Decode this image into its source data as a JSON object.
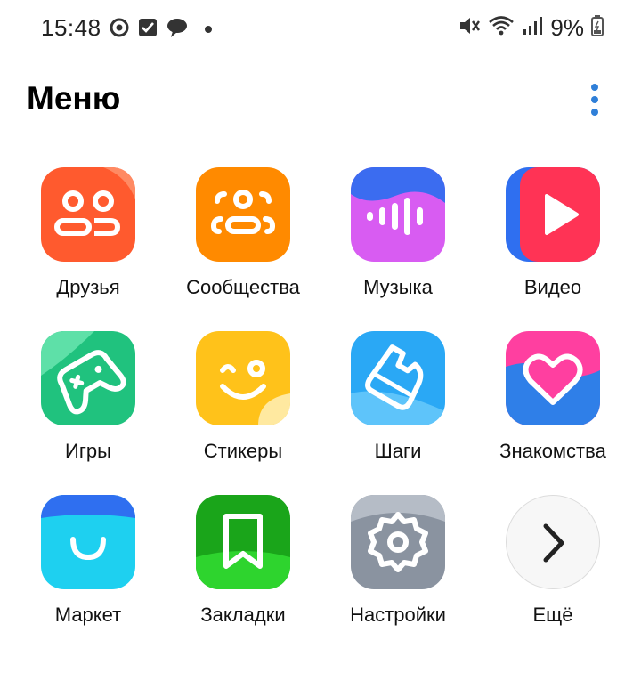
{
  "status_bar": {
    "time": "15:48",
    "battery_percent": "9%",
    "left_icons": [
      "vk-circle-icon",
      "checkbox-icon",
      "chat-bubble-icon",
      "dot-icon"
    ],
    "right_icons": [
      "mute-icon",
      "wifi-icon",
      "signal-icon",
      "battery-icon"
    ]
  },
  "header": {
    "title": "Меню",
    "more_icon": "more-vertical-icon",
    "accent_color": "#2f7fd8"
  },
  "menu_items": [
    {
      "label": "Друзья",
      "icon": "friends-icon",
      "color": "#ff5a2e"
    },
    {
      "label": "Сообщества",
      "icon": "communities-icon",
      "color": "#ff8a00"
    },
    {
      "label": "Музыка",
      "icon": "music-icon",
      "color": "#d85cf2"
    },
    {
      "label": "Видео",
      "icon": "video-icon",
      "color": "#ff3355"
    },
    {
      "label": "Игры",
      "icon": "games-icon",
      "color": "#2ec784"
    },
    {
      "label": "Стикеры",
      "icon": "stickers-icon",
      "color": "#ffc21a"
    },
    {
      "label": "Шаги",
      "icon": "steps-icon",
      "color": "#2aa8f5"
    },
    {
      "label": "Знакомства",
      "icon": "dating-icon",
      "color": "#ff3fa0"
    },
    {
      "label": "Маркет",
      "icon": "market-icon",
      "color": "#1ed0f0"
    },
    {
      "label": "Закладки",
      "icon": "bookmarks-icon",
      "color": "#1bb51b"
    },
    {
      "label": "Настройки",
      "icon": "settings-icon",
      "color": "#8a93a0"
    },
    {
      "label": "Ещё",
      "icon": "chevron-right-icon",
      "color": "#f7f7f7"
    }
  ]
}
